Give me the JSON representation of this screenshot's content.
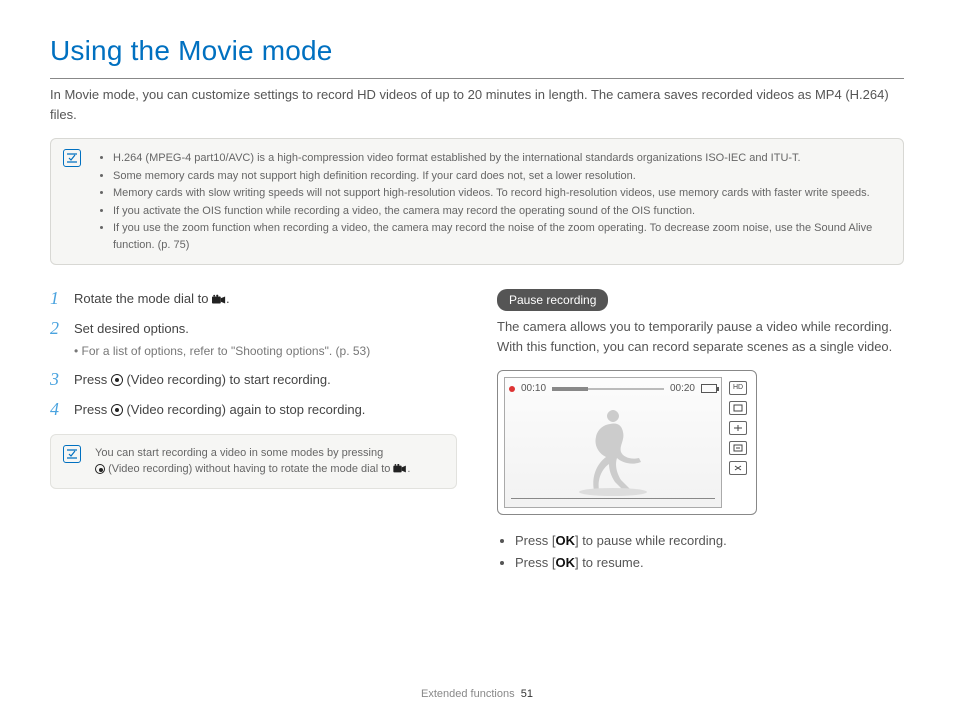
{
  "title": "Using the Movie mode",
  "intro": "In Movie mode, you can customize settings to record HD videos of up to 20 minutes in length. The camera saves recorded videos as MP4 (H.264) files.",
  "notes": [
    "H.264 (MPEG-4 part10/AVC) is a high-compression video format established by the international standards organizations ISO-IEC and ITU-T.",
    "Some memory cards may not support high definition recording. If your card does not, set a lower resolution.",
    "Memory cards with slow writing speeds will not support high-resolution videos. To record high-resolution videos, use memory cards with faster write speeds.",
    "If you activate the OIS function while recording a video, the camera may record the operating sound of the OIS function.",
    "If you use the zoom function when recording a video, the camera may record the noise of the zoom operating. To decrease zoom noise, use the Sound Alive function. (p. 75)"
  ],
  "steps": {
    "s1": {
      "num": "1",
      "text_a": "Rotate the mode dial to ",
      "text_b": "."
    },
    "s2": {
      "num": "2",
      "text": "Set desired options.",
      "sub": "For a list of options, refer to \"Shooting options\". (p. 53)"
    },
    "s3": {
      "num": "3",
      "text_a": "Press ",
      "text_b": " (Video recording) to start recording."
    },
    "s4": {
      "num": "4",
      "text_a": "Press ",
      "text_b": " (Video recording) again to stop recording."
    }
  },
  "tip_a": "You can start recording a video in some modes by pressing",
  "tip_b": " (Video recording) without having to rotate the mode dial to ",
  "tip_c": ".",
  "pause": {
    "label": "Pause recording",
    "text": "The camera allows you to temporarily pause a video while recording. With this function, you can record separate scenes as a single video.",
    "lcd": {
      "elapsed": "00:10",
      "total": "00:20",
      "side": [
        "HD",
        "",
        "",
        "",
        ""
      ]
    },
    "b1_a": "Press [",
    "b1_b": "] to pause while recording.",
    "b2_a": "Press [",
    "b2_b": "] to resume.",
    "ok": "OK"
  },
  "footer": {
    "section": "Extended functions",
    "page": "51"
  }
}
